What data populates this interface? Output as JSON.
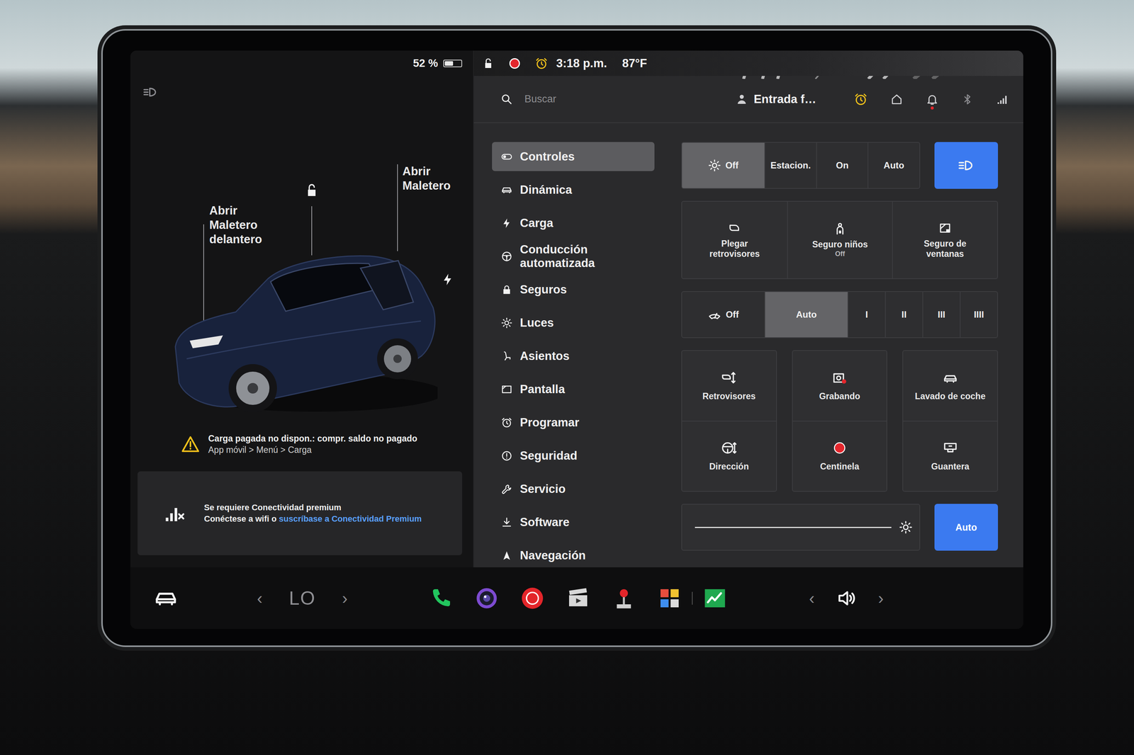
{
  "left_panel": {
    "battery": {
      "reading": "52 %",
      "level": 0.52
    },
    "doors_locked": false,
    "car_labels": {
      "frunk": "Abrir Maletero delantero",
      "trunk": "Abrir Maletero"
    },
    "warning": {
      "title": "Carga pagada no dispon.: compr. saldo no pagado",
      "path": "App móvil > Menú > Carga"
    },
    "connectivity": {
      "title": "Se requiere Conectividad premium",
      "text": "Conéctese a wifi o ",
      "link": "suscríbase a Conectividad Premium"
    }
  },
  "status_bar": {
    "locked": false,
    "recording": true,
    "time": "3:18 p.m.",
    "temperature": "87°F"
  },
  "search": {
    "placeholder": "Buscar"
  },
  "profile": {
    "name": "Entrada f…"
  },
  "notifications": {
    "unread": true
  },
  "sidebar": {
    "items": [
      {
        "label": "Controles",
        "kind": "toggle",
        "selected": true
      },
      {
        "label": "Dinámica",
        "kind": "car",
        "selected": false
      },
      {
        "label": "Carga",
        "kind": "bolt",
        "selected": false
      },
      {
        "label": "Conducción automatizada",
        "kind": "wheel",
        "selected": false
      },
      {
        "label": "Seguros",
        "kind": "lock",
        "selected": false
      },
      {
        "label": "Luces",
        "kind": "sun",
        "selected": false
      },
      {
        "label": "Asientos",
        "kind": "seat",
        "selected": false
      },
      {
        "label": "Pantalla",
        "kind": "display",
        "selected": false
      },
      {
        "label": "Programar",
        "kind": "clock",
        "selected": false
      },
      {
        "label": "Seguridad",
        "kind": "alert",
        "selected": false
      },
      {
        "label": "Servicio",
        "kind": "wrench",
        "selected": false
      },
      {
        "label": "Software",
        "kind": "download",
        "selected": false
      },
      {
        "label": "Navegación",
        "kind": "navigate",
        "selected": false
      }
    ]
  },
  "controls": {
    "headlights": {
      "options": [
        {
          "label": "Off",
          "kind": "with-icon",
          "selected": true
        },
        {
          "label": "Estacion.",
          "kind": "plain",
          "selected": false
        },
        {
          "label": "On",
          "kind": "plain",
          "selected": false
        },
        {
          "label": "Auto",
          "kind": "plain",
          "selected": false
        }
      ]
    },
    "auto_high_beam": {
      "on": true
    },
    "tiles": [
      {
        "label": "Plegar retrovisores",
        "kind": "mirror-fold"
      },
      {
        "label": "Seguro niños",
        "status": "Off",
        "kind": "child-lock"
      },
      {
        "label": "Seguro de ventanas",
        "kind": "window-lock"
      }
    ],
    "wipers": {
      "options": [
        {
          "label": "Off",
          "kind": "with-icon",
          "selected": false
        },
        {
          "label": "Auto",
          "kind": "plain",
          "selected": true
        },
        {
          "label": "I",
          "kind": "plain",
          "selected": false
        },
        {
          "label": "II",
          "kind": "plain",
          "selected": false
        },
        {
          "label": "III",
          "kind": "plain",
          "selected": false
        },
        {
          "label": "IIII",
          "kind": "plain",
          "selected": false
        }
      ]
    },
    "shortcuts": [
      [
        {
          "label": "Retrovisores",
          "kind": "mirror-adjust"
        },
        {
          "label": "Dirección",
          "kind": "steering-adjust"
        }
      ],
      [
        {
          "label": "Grabando",
          "kind": "camera-rec"
        },
        {
          "label": "Centinela",
          "kind": "sentry"
        }
      ],
      [
        {
          "label": "Lavado de coche",
          "kind": "car-wash"
        },
        {
          "label": "Guantera",
          "kind": "glovebox"
        }
      ]
    ],
    "brightness": {
      "level": 1,
      "auto": {
        "label": "Auto",
        "on": true
      }
    }
  },
  "dock": {
    "climate": {
      "prev": "‹",
      "value": "LO",
      "next": "›"
    },
    "apps": [
      {
        "kind": "phone"
      },
      {
        "kind": "camera"
      },
      {
        "kind": "media"
      },
      {
        "kind": "theater"
      },
      {
        "kind": "arcade"
      },
      {
        "kind": "toybox"
      },
      {
        "kind": "stocks"
      }
    ],
    "volume": {
      "prev": "‹",
      "next": "›"
    }
  }
}
